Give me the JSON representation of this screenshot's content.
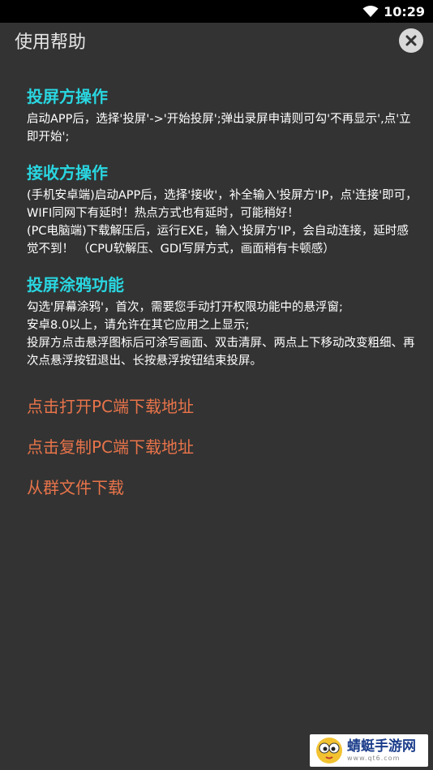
{
  "status_bar": {
    "time": "10:29"
  },
  "header": {
    "title": "使用帮助"
  },
  "sections": [
    {
      "title": "投屏方操作",
      "paragraphs": [
        "启动APP后，选择'投屏'->'开始投屏';弹出录屏申请则可勾'不再显示',点'立即开始';"
      ]
    },
    {
      "title": "接收方操作",
      "paragraphs": [
        "(手机安卓端)启动APP后，选择'接收'，补全输入'投屏方'IP，点'连接'即可，WIFI同网下有延时！热点方式也有延时，可能稍好！",
        "(PC电脑端)下载解压后，运行EXE，输入'投屏方'IP，会自动连接，延时感觉不到！ （CPU软解压、GDI写屏方式，画面稍有卡顿感）"
      ]
    },
    {
      "title": "投屏涂鸦功能",
      "paragraphs": [
        "勾选'屏幕涂鸦'，首次，需要您手动打开权限功能中的悬浮窗;",
        "安卓8.0以上，请允许在其它应用之上显示;",
        "投屏方点击悬浮图标后可涂写画面、双击清屏、两点上下移动改变粗细、再次点悬浮按钮退出、长按悬浮按钮结束投屏。"
      ]
    }
  ],
  "links": {
    "open_pc": "点击打开PC端下载地址",
    "copy_pc": "点击复制PC端下载地址",
    "group_download": "从群文件下载"
  },
  "watermark": {
    "name": "蜻蜓手游网",
    "url": "www.qt6.com"
  },
  "colors": {
    "background": "#333333",
    "section_title": "#29d6e0",
    "link": "#e8744a"
  },
  "icons": {
    "wifi": "wifi-icon",
    "close": "close-icon",
    "mascot": "mascot-icon"
  }
}
